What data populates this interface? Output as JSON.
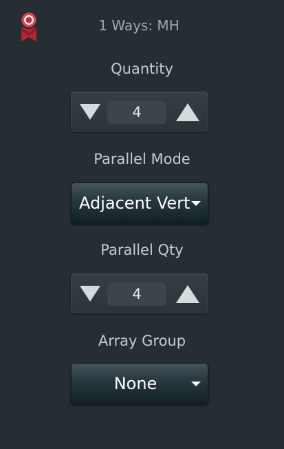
{
  "header": {
    "title": "1 Ways: MH",
    "badge_icon": "award-ribbon-icon"
  },
  "quantity": {
    "label": "Quantity",
    "value": "4"
  },
  "parallel_mode": {
    "label": "Parallel Mode",
    "selected": "Adjacent Vert"
  },
  "parallel_qty": {
    "label": "Parallel Qty",
    "value": "4"
  },
  "array_group": {
    "label": "Array Group",
    "selected": "None"
  },
  "colors": {
    "background": "#262d33",
    "badge_red": "#c0303a",
    "dropdown_dark": "#122126"
  }
}
